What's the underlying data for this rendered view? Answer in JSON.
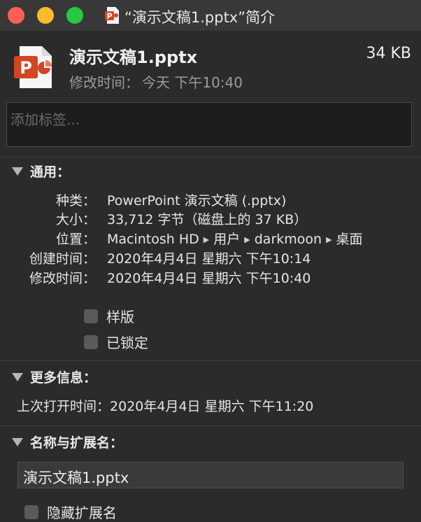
{
  "window": {
    "title": "“演示文稿1.pptx”简介"
  },
  "header": {
    "file_name": "演示文稿1.pptx",
    "file_size": "34 KB",
    "modified_label": "修改时间：",
    "modified_value": "今天 下午10:40"
  },
  "tags": {
    "placeholder": "添加标签..."
  },
  "general": {
    "heading": "通用：",
    "rows": [
      {
        "label": "种类：",
        "value": "PowerPoint 演示文稿 (.pptx)"
      },
      {
        "label": "大小：",
        "value": "33,712 字节（磁盘上的 37 KB）"
      },
      {
        "label": "位置：",
        "path": [
          "Macintosh HD",
          "用户",
          "darkmoon",
          "桌面"
        ]
      },
      {
        "label": "创建时间：",
        "value": "2020年4月4日 星期六 下午10:14"
      },
      {
        "label": "修改时间：",
        "value": "2020年4月4日 星期六 下午10:40"
      }
    ],
    "stationery_label": "样版",
    "locked_label": "已锁定",
    "path_separator": "▶"
  },
  "more_info": {
    "heading": "更多信息：",
    "last_opened_label": "上次打开时间：",
    "last_opened_value": "2020年4月4日 星期六 下午11:20"
  },
  "name_ext": {
    "heading": "名称与扩展名：",
    "name_value": "演示文稿1.pptx",
    "hide_ext_label": "隐藏扩展名"
  },
  "colors": {
    "close": "#fe5f57",
    "minimize": "#febb2e",
    "maximize": "#28c840",
    "ppt_orange": "#d24625"
  }
}
